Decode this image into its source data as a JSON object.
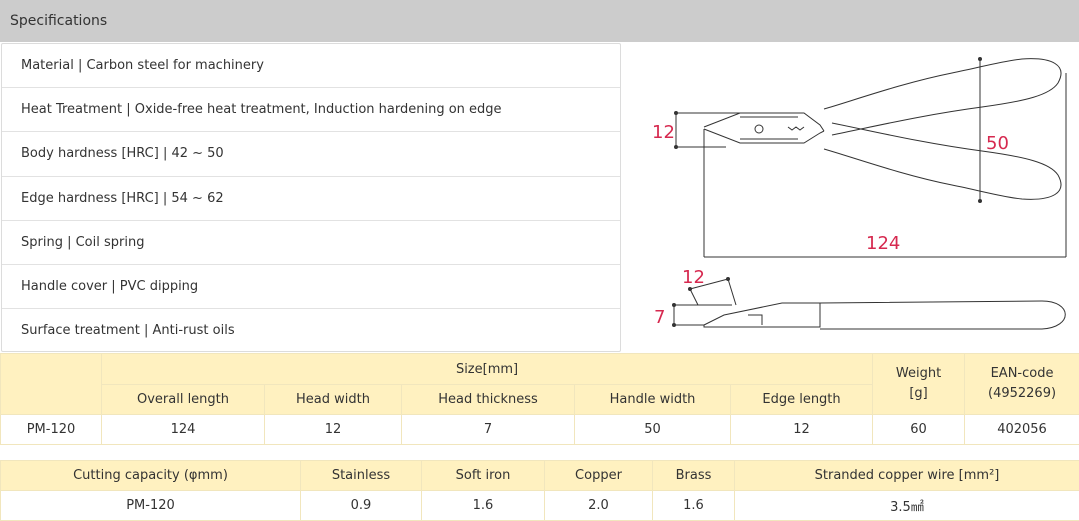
{
  "header": {
    "title": "Specifications"
  },
  "specs": [
    "Material | Carbon steel for machinery",
    "Heat Treatment | Oxide-free heat treatment, Induction hardening on edge",
    "Body hardness [HRC] | 42 ~ 50",
    "Edge hardness [HRC] | 54 ~ 62",
    "Spring | Coil spring",
    "Handle cover | PVC dipping",
    "Surface treatment | Anti-rust oils"
  ],
  "diagram": {
    "head_width": "12",
    "handle_width": "50",
    "overall_length": "124",
    "edge_length": "12",
    "head_thickness": "7",
    "dimension_color": "#d6294f"
  },
  "size_table": {
    "size_group": "Size[mm]",
    "columns": [
      "Overall length",
      "Head width",
      "Head thickness",
      "Handle width",
      "Edge length"
    ],
    "weight_header": "Weight\n[g]",
    "ean_header": "EAN-code\n(4952269)",
    "row": [
      "PM-120",
      "124",
      "12",
      "7",
      "50",
      "12",
      "60",
      "402056"
    ]
  },
  "cutting_table": {
    "headers": [
      "Cutting capacity (φmm)",
      "Stainless",
      "Soft iron",
      "Copper",
      "Brass",
      "Stranded copper wire [mm²]"
    ],
    "row": [
      "PM-120",
      "0.9",
      "1.6",
      "2.0",
      "1.6",
      "3.5㎟"
    ]
  },
  "colors": {
    "header_bg": "#cccccc",
    "table_header_bg": "#fff1c0"
  }
}
